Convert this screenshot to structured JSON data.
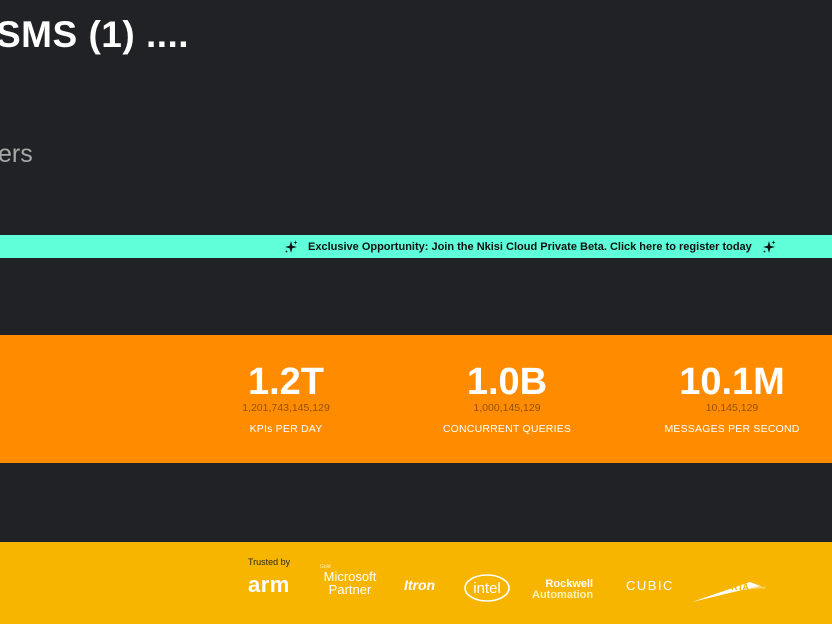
{
  "hero": {
    "title": "SMS (1) ....",
    "subtitle": "ers"
  },
  "banner": {
    "text": "Exclusive Opportunity: Join the Nkisi Cloud Private Beta. Click here to register today",
    "icon": "sparkle-icon",
    "background": "#5effd9"
  },
  "stats": {
    "background": "#ff8c00",
    "items": [
      {
        "value": "1.2T",
        "exact": "1,201,743,145,129",
        "label": "KPIs PER DAY"
      },
      {
        "value": "1.0B",
        "exact": "1,000,145,129",
        "label": "CONCURRENT QUERIES"
      },
      {
        "value": "10.1M",
        "exact": "10,145,129",
        "label": "MESSAGES PER SECOND"
      }
    ]
  },
  "trusted": {
    "label": "Trusted by",
    "background": "#f7b500",
    "logos": {
      "arm": "arm",
      "microsoft_top": "Gold",
      "microsoft_line1": "Microsoft",
      "microsoft_line2": "Partner",
      "itron": "Itron",
      "intel": "intel",
      "rockwell_line1": "Rockwell",
      "rockwell_line2": "Automation",
      "cubic": "CUBIC",
      "rta": "RTA"
    }
  }
}
